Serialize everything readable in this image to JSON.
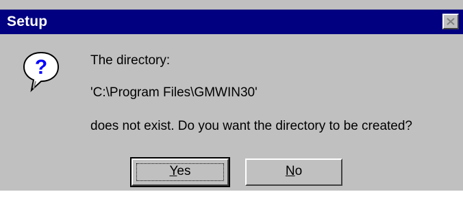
{
  "window": {
    "title": "Setup",
    "close_icon": "close-icon"
  },
  "icon": "question-icon",
  "message": {
    "line1": "The directory:",
    "line2": "'C:\\Program Files\\GMWIN30'",
    "line3": "does not exist.  Do you want the directory to be created?"
  },
  "buttons": {
    "yes": {
      "mnemonic": "Y",
      "rest": "es"
    },
    "no": {
      "mnemonic": "N",
      "rest": "o"
    }
  },
  "colors": {
    "titlebar": "#000080",
    "face": "#c0c0c0",
    "icon_blue": "#0000ff"
  }
}
